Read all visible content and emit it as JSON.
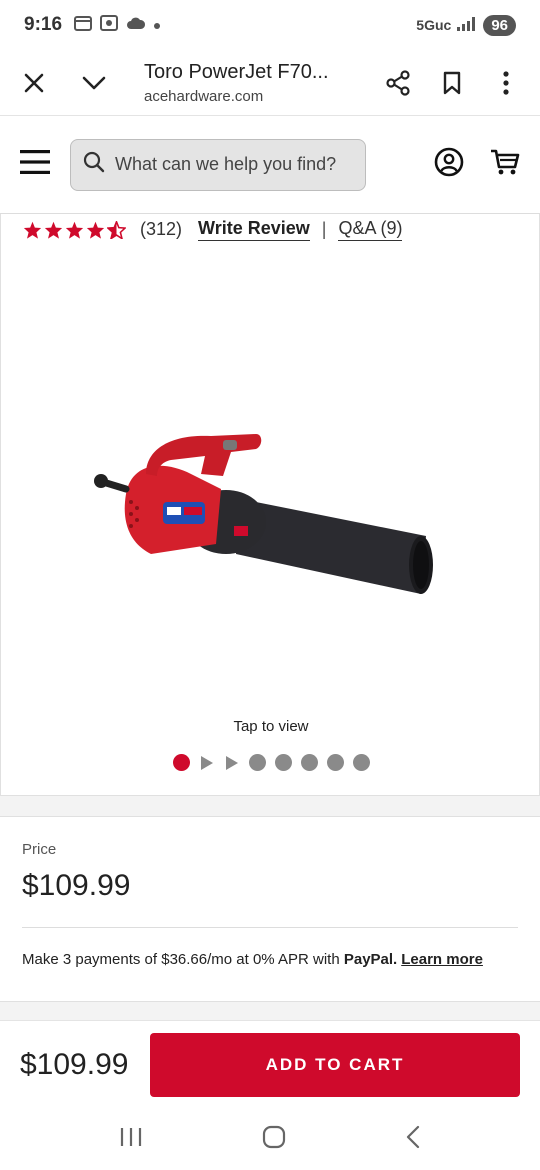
{
  "status_bar": {
    "time": "9:16",
    "network": "5Guc",
    "battery": "96"
  },
  "browser": {
    "title": "Toro PowerJet F70...",
    "url": "acehardware.com"
  },
  "header": {
    "search_placeholder": "What can we help you find?"
  },
  "product": {
    "rating": 4.5,
    "review_count": "(312)",
    "write_review": "Write Review",
    "separator": "|",
    "qa": "Q&A (9)",
    "tap_to_view": "Tap to view",
    "gallery_active_index": 0
  },
  "price_card": {
    "label": "Price",
    "value": "$109.99",
    "paypal_prefix": "Make 3 payments of $36.66/mo at 0% APR with ",
    "paypal_brand": "PayPal.",
    "learn_more": "Learn more"
  },
  "bottom_bar": {
    "price": "$109.99",
    "add_to_cart": "ADD TO CART"
  },
  "colors": {
    "brand_red": "#cf0a2c",
    "dot_gray": "#8a8a8a"
  }
}
